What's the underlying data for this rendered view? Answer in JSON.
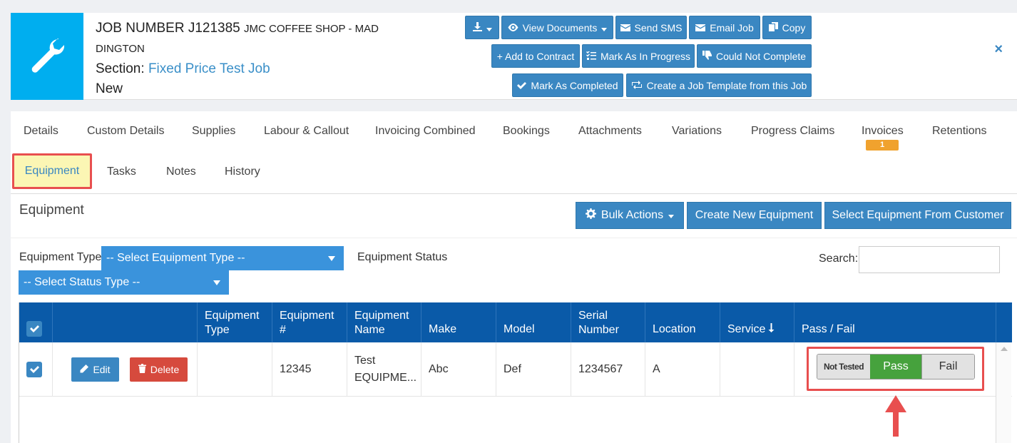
{
  "header": {
    "job_number": "JOB NUMBER J121385",
    "customer_part1": "JMC COFFEE SHOP - MAD",
    "customer_part2": "DINGTON",
    "section_label": "Section:",
    "section_value": "Fixed Price Test Job",
    "status": "New",
    "tile_icon": "wrench-icon",
    "buttons": {
      "view_documents": "View Documents",
      "send_sms": "Send SMS",
      "email_job": "Email Job",
      "copy": "Copy",
      "add_to_contract": "+ Add to Contract",
      "mark_in_progress": "Mark As In Progress",
      "could_not_complete": "Could Not Complete",
      "mark_completed": "Mark As Completed",
      "create_template": "Create a Job Template from this Job"
    },
    "close": "×"
  },
  "tabs": {
    "details": "Details",
    "custom_details": "Custom Details",
    "supplies": "Supplies",
    "labour": "Labour & Callout",
    "invoicing": "Invoicing Combined",
    "bookings": "Bookings",
    "attachments": "Attachments",
    "variations": "Variations",
    "progress_claims": "Progress Claims",
    "invoices": "Invoices",
    "invoices_badge": "1",
    "retentions": "Retentions",
    "equipment": "Equipment",
    "tasks": "Tasks",
    "notes": "Notes",
    "history": "History"
  },
  "equipment": {
    "title": "Equipment",
    "bulk_actions": "Bulk Actions",
    "create_new": "Create New Equipment",
    "select_from_customer": "Select Equipment From Customer",
    "filters": {
      "type_label": "Equipment Type",
      "type_value": "-- Select Equipment Type --",
      "status_label": "Equipment Status",
      "status_value": "-- Select Status Type --",
      "search_label": "Search:"
    },
    "table": {
      "headers": {
        "type_1": "Equipment",
        "type_2": "Type",
        "num_1": "Equipment",
        "num_2": "#",
        "name_1": "Equipment",
        "name_2": "Name",
        "make": "Make",
        "model": "Model",
        "serial_1": "Serial",
        "serial_2": "Number",
        "location": "Location",
        "service": "Service",
        "pass_fail": "Pass / Fail"
      },
      "rows": [
        {
          "edit": "Edit",
          "delete": "Delete",
          "type": "",
          "number": "12345",
          "name_1": "Test",
          "name_2": "EQUIPME...",
          "make": "Abc",
          "model": "Def",
          "serial": "1234567",
          "location": "A",
          "service": "",
          "not_tested": "Not Tested",
          "pass": "Pass",
          "fail": "Fail"
        }
      ]
    }
  },
  "colors": {
    "primary": "#3a87c2",
    "tile": "#00aeef",
    "table_header": "#0a5aa8",
    "danger": "#d64a3d",
    "success": "#46a23d",
    "badge": "#f0a22e",
    "highlight_outline": "#e84f4f"
  }
}
